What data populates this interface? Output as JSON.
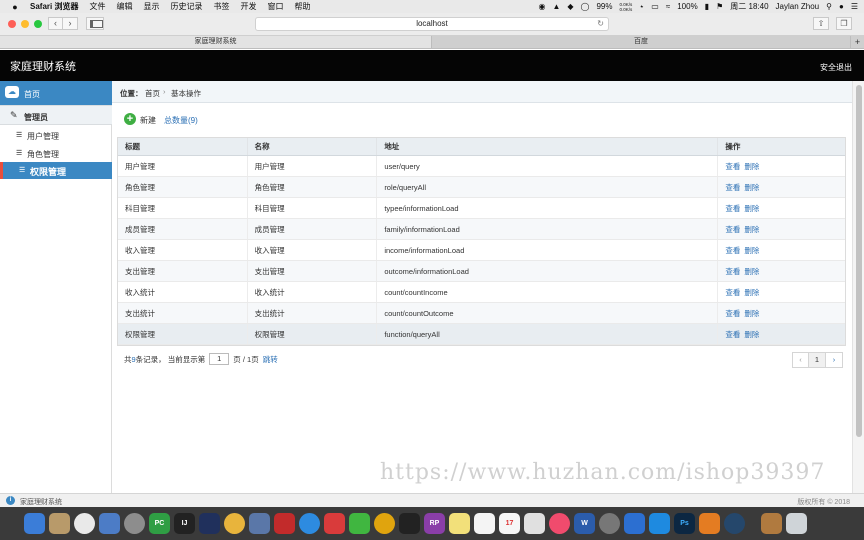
{
  "menubar": {
    "apple": "",
    "items": [
      "Safari 浏览器",
      "文件",
      "编辑",
      "显示",
      "历史记录",
      "书签",
      "开发",
      "窗口",
      "帮助"
    ],
    "status": {
      "net_up": "0.0K/s",
      "net_down": "0.0K/s",
      "cpu": "99%",
      "battery": "100%",
      "datetime": "周二 18:40",
      "user": "Jaylan Zhou"
    }
  },
  "browser": {
    "url": "localhost",
    "tabs": [
      "家庭理财系统",
      "百度"
    ],
    "new_tab": "+"
  },
  "app": {
    "title": "家庭理财系统",
    "logout": "安全退出"
  },
  "sidebar": {
    "home": "首页",
    "group": "管理员",
    "items": [
      {
        "label": "用户管理",
        "active": false
      },
      {
        "label": "角色管理",
        "active": false
      },
      {
        "label": "权限管理",
        "active": true
      }
    ]
  },
  "breadcrumb": {
    "position_label": "位置：",
    "home": "首页",
    "separator": "›",
    "current": "基本操作"
  },
  "toolbar": {
    "add_label": "新建",
    "total_label": "总数量(9)"
  },
  "table": {
    "headers": [
      "标题",
      "名称",
      "地址",
      "操作"
    ],
    "rows": [
      {
        "title": "用户管理",
        "name": "用户管理",
        "address": "user/query"
      },
      {
        "title": "角色管理",
        "name": "角色管理",
        "address": "role/queryAll"
      },
      {
        "title": "科目管理",
        "name": "科目管理",
        "address": "typee/informationLoad"
      },
      {
        "title": "成员管理",
        "name": "成员管理",
        "address": "family/informationLoad"
      },
      {
        "title": "收入管理",
        "name": "收入管理",
        "address": "income/informationLoad"
      },
      {
        "title": "支出管理",
        "name": "支出管理",
        "address": "outcome/informationLoad"
      },
      {
        "title": "收入统计",
        "name": "收入统计",
        "address": "count/countIncome"
      },
      {
        "title": "支出统计",
        "name": "支出统计",
        "address": "count/countOutcome"
      },
      {
        "title": "权限管理",
        "name": "权限管理",
        "address": "function/queryAll"
      }
    ],
    "op_view": "查看",
    "op_delete": "删除"
  },
  "pagination": {
    "prefix": "共",
    "total": "9",
    "records_text": "条记录，  当前显示第",
    "current_page": "1",
    "page_suffix": "页 / 1页",
    "jump": "跳转",
    "prev": "‹",
    "page_button": "1",
    "next": "›"
  },
  "statusbar": {
    "name": "家庭理财系统",
    "copyright": "版权所有 © 2018"
  },
  "watermark": "https://www.huzhan.com/ishop39397",
  "colors": {
    "header_bg": "#050505",
    "accent_blue": "#3b88c3",
    "active_border": "#e94e3c",
    "link": "#2a6fb4",
    "add_green": "#3fae43"
  }
}
